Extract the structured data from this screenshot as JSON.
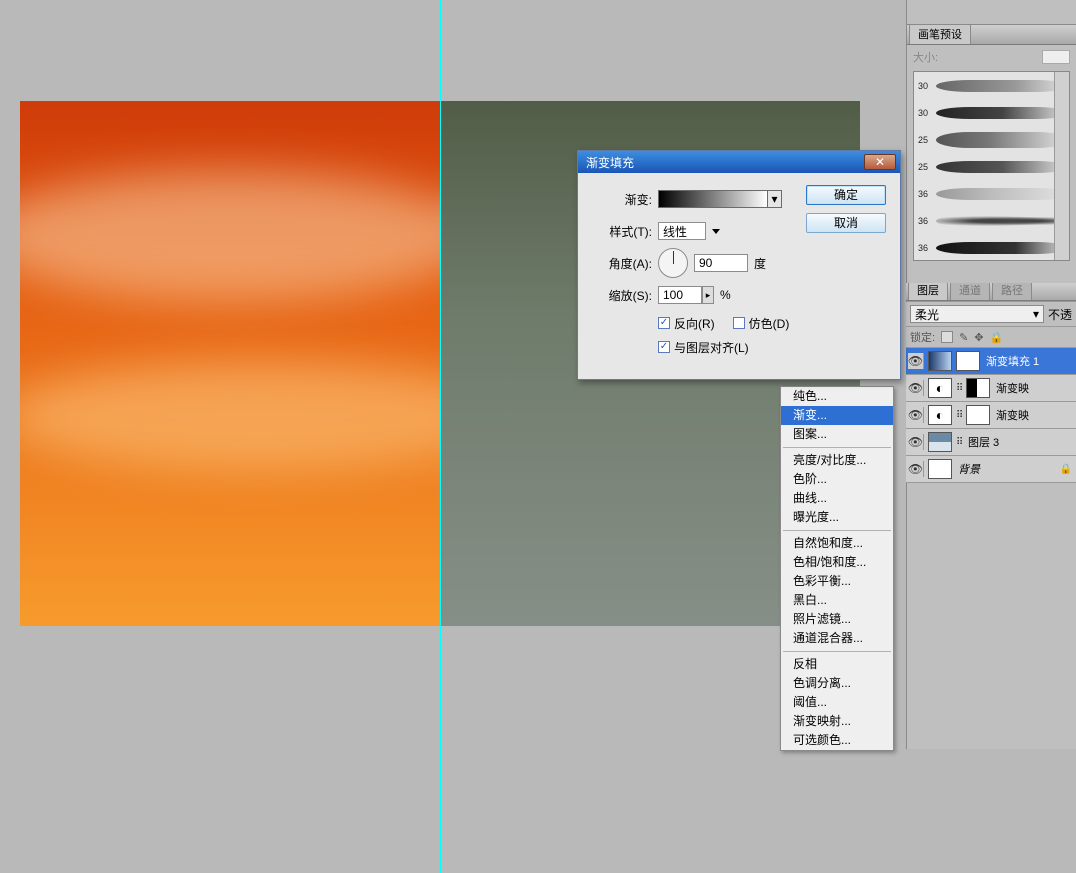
{
  "brushPanel": {
    "tab": "画笔预设",
    "sizeLabel": "大小:",
    "brushSizes": [
      "30",
      "30",
      "25",
      "25",
      "36",
      "36",
      "36"
    ]
  },
  "dialog": {
    "title": "渐变填充",
    "ok": "确定",
    "cancel": "取消",
    "gradientLabel": "渐变:",
    "styleLabel": "样式(T):",
    "styleValue": "线性",
    "angleLabel": "角度(A):",
    "angleValue": "90",
    "angleUnit": "度",
    "scaleLabel": "缩放(S):",
    "scaleValue": "100",
    "scaleUnit": "%",
    "reverse": "反向(R)",
    "dither": "仿色(D)",
    "align": "与图层对齐(L)",
    "reverseChecked": true,
    "ditherChecked": false,
    "alignChecked": true
  },
  "contextMenu": {
    "groups": [
      [
        "纯色...",
        "渐变...",
        "图案..."
      ],
      [
        "亮度/对比度...",
        "色阶...",
        "曲线...",
        "曝光度..."
      ],
      [
        "自然饱和度...",
        "色相/饱和度...",
        "色彩平衡...",
        "黑白...",
        "照片滤镜...",
        "通道混合器..."
      ],
      [
        "反相",
        "色调分离...",
        "阈值...",
        "渐变映射...",
        "可选颜色..."
      ]
    ],
    "highlighted": "渐变..."
  },
  "layersPanel": {
    "tabs": [
      "图层",
      "通道",
      "路径"
    ],
    "blendMode": "柔光",
    "opacityLabel": "不透",
    "lockLabel": "锁定:",
    "layers": [
      {
        "name": "渐变填充 1",
        "type": "grad",
        "mask": "mask",
        "sel": true
      },
      {
        "name": "渐变映",
        "type": "adj",
        "mask": "maskL",
        "link": true
      },
      {
        "name": "渐变映",
        "type": "adj",
        "mask": "mask",
        "link": true
      },
      {
        "name": "图层 3",
        "type": "sky",
        "link": true
      },
      {
        "name": "背景",
        "type": "plain",
        "ital": true,
        "locked": true
      }
    ]
  }
}
